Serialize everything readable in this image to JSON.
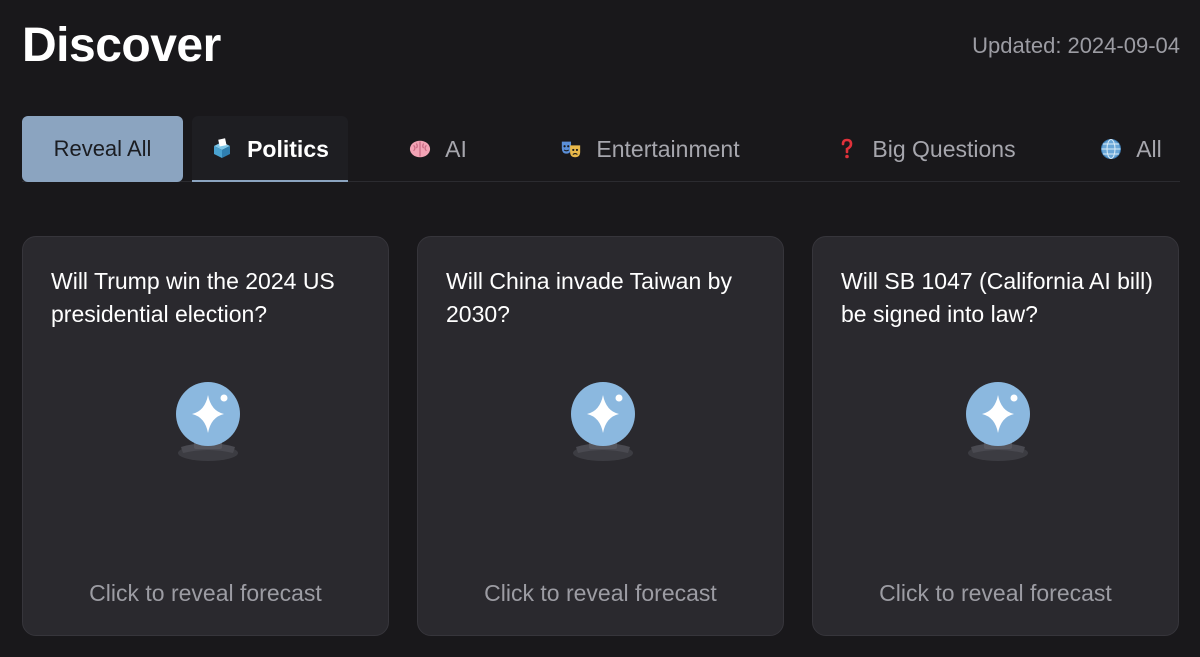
{
  "header": {
    "title": "Discover",
    "updated_label": "Updated:",
    "updated_date": "2024-09-04"
  },
  "toolbar": {
    "reveal_all_label": "Reveal All"
  },
  "tabs": [
    {
      "label": "Politics",
      "icon": "ballot-box-icon",
      "active": true
    },
    {
      "label": "AI",
      "icon": "brain-icon",
      "active": false
    },
    {
      "label": "Entertainment",
      "icon": "theater-masks-icon",
      "active": false
    },
    {
      "label": "Big Questions",
      "icon": "question-mark-icon",
      "active": false
    },
    {
      "label": "All",
      "icon": "globe-icon",
      "active": false
    }
  ],
  "cards": [
    {
      "question": "Will Trump win the 2024 US presidential election?",
      "cta": "Click to reveal forecast"
    },
    {
      "question": "Will China invade Taiwan by 2030?",
      "cta": "Click to reveal forecast"
    },
    {
      "question": "Will SB 1047 (California AI bill) be signed into law?",
      "cta": "Click to reveal forecast"
    }
  ],
  "colors": {
    "background": "#19181b",
    "card": "#2a292e",
    "accent": "#8ba4c0",
    "orb": "#8bb8df",
    "muted_text": "#9c9ca3"
  }
}
